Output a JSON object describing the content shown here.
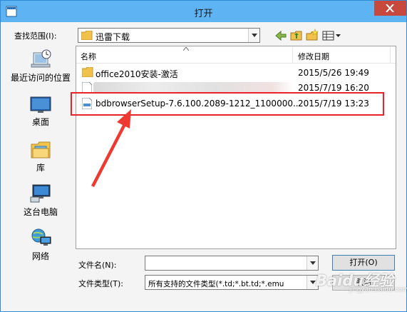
{
  "window": {
    "title": "打开"
  },
  "lookin": {
    "label": "查找范围(I):",
    "value": "迅雷下载"
  },
  "toolbar": {
    "back": "back-arrow-icon",
    "up": "folder-up-icon",
    "new_folder": "new-folder-icon",
    "view": "view-menu-icon"
  },
  "places": [
    {
      "label": "最近访问的位置",
      "icon": "recent-places-icon"
    },
    {
      "label": "桌面",
      "icon": "desktop-icon"
    },
    {
      "label": "库",
      "icon": "libraries-icon"
    },
    {
      "label": "这台电脑",
      "icon": "this-pc-icon"
    },
    {
      "label": "网络",
      "icon": "network-icon"
    }
  ],
  "filelist": {
    "columns": {
      "name": "名称",
      "date": "修改日期"
    },
    "rows": [
      {
        "name": "office2010安装-激活",
        "date": "2015/5/26 19:49",
        "icon": "folder-icon"
      },
      {
        "name": "",
        "date": "2015/7/19 16:20",
        "icon": "file-icon"
      },
      {
        "name": "bdbrowserSetup-7.6.100.2089-1212_1100000...",
        "date": "2015/7/19 13:23",
        "icon": "file-icon"
      }
    ]
  },
  "filename": {
    "label": "文件名(N):",
    "value": ""
  },
  "filetype": {
    "label": "文件类型(T):",
    "value": "所有支持的文件类型(*.td;*.bt.td;*.emu"
  },
  "buttons": {
    "open": "打开(O)",
    "cancel": "取消"
  },
  "watermark": {
    "text": "Baidu经验",
    "sub": "jingyan.baidu.com"
  },
  "colors": {
    "titlebar": "#5eb3f3",
    "highlight": "#e8242a",
    "close": "#c7483d"
  }
}
